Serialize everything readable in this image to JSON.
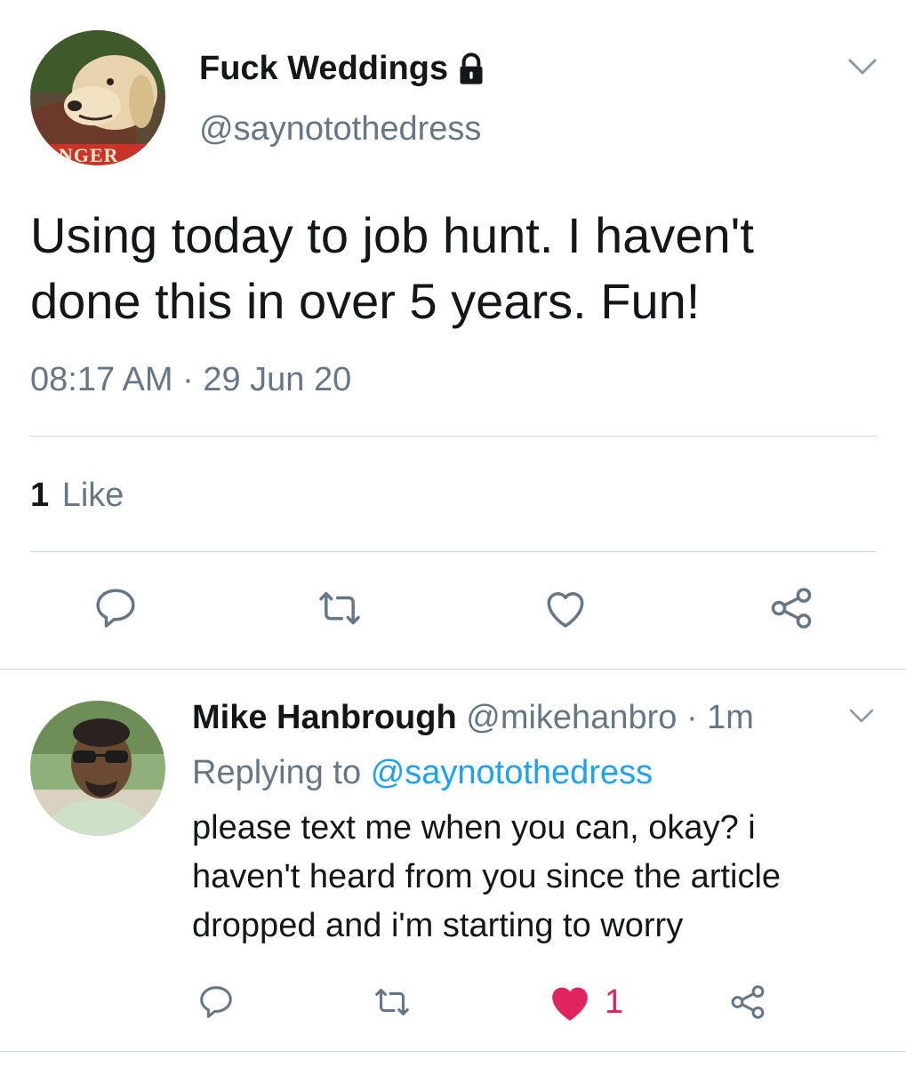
{
  "tweet": {
    "author_name": "Fuck Weddings",
    "author_handle": "@saynotothedress",
    "avatar_caption": "NGER",
    "text_line1": "Using today to job hunt. I haven't",
    "text_line2": "done this in over 5 years. Fun!",
    "time": "08:17 AM",
    "date_sep": "·",
    "date": "29 Jun 20",
    "likes_count": "1",
    "likes_label": "Like"
  },
  "reply": {
    "author_name": "Mike Hanbrough",
    "author_handle": "@mikehanbro",
    "time_sep": "·",
    "time": "1m",
    "replying_prefix": "Replying to",
    "replying_handle": "@saynotothedress",
    "text_line1": "please text me when you can, okay? i",
    "text_line2": "haven't heard from you since the article",
    "text_line3": "dropped and i'm starting to worry",
    "like_count": "1"
  },
  "colors": {
    "text": "#14171a",
    "secondary": "#657786",
    "link": "#1da1f2",
    "liked": "#e0245e",
    "divider": "#ccd6dd"
  },
  "icons": [
    "chevron-down-icon",
    "lock-icon",
    "reply-icon",
    "retweet-icon",
    "like-icon",
    "share-icon",
    "liked-heart-icon"
  ]
}
